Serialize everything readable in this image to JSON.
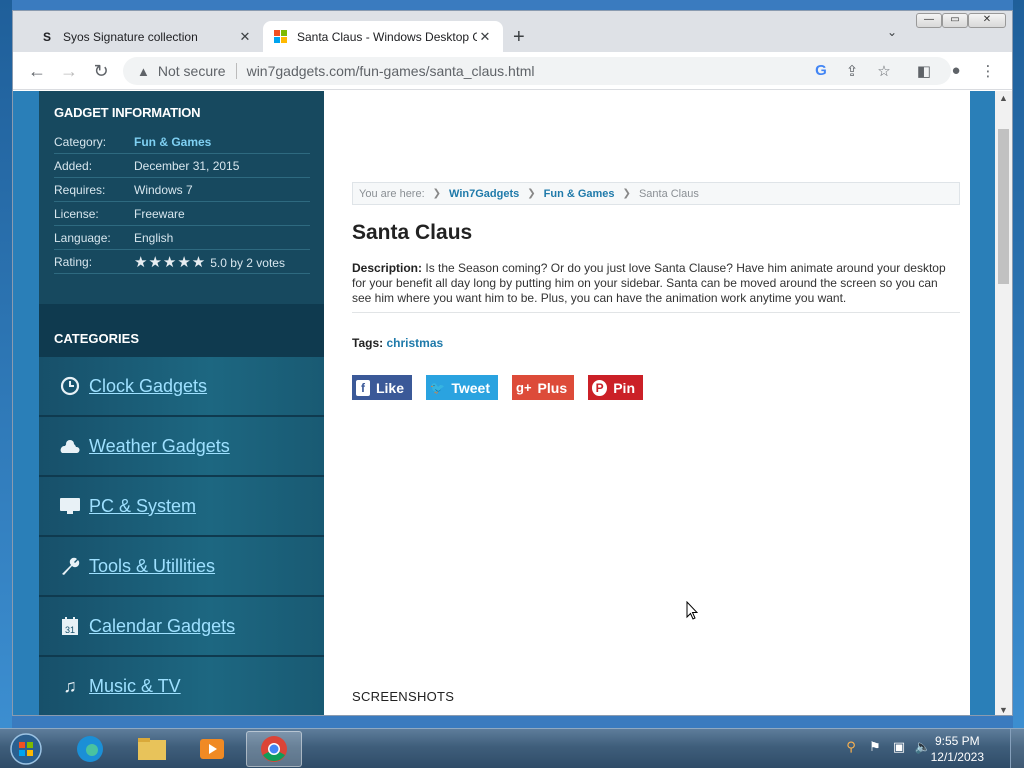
{
  "browser": {
    "tabs": [
      {
        "title": "Syos Signature collection",
        "favicon": "S"
      },
      {
        "title": "Santa Claus - Windows Desktop G",
        "favicon": "windows-logo"
      }
    ],
    "address": {
      "security": "Not secure",
      "url": "win7gadgets.com/fun-games/santa_claus.html"
    }
  },
  "sidebar": {
    "info_heading": "GADGET INFORMATION",
    "info": [
      {
        "key": "Category:",
        "value": "Fun & Games"
      },
      {
        "key": "Added:",
        "value": "December 31, 2015"
      },
      {
        "key": "Requires:",
        "value": "Windows 7"
      },
      {
        "key": "License:",
        "value": "Freeware"
      },
      {
        "key": "Language:",
        "value": "English"
      }
    ],
    "rating": {
      "key": "Rating:",
      "stars": 5,
      "text": "5.0 by 2 votes"
    },
    "categories_heading": "CATEGORIES",
    "categories": [
      {
        "label": "Clock Gadgets",
        "icon": "clock-icon"
      },
      {
        "label": "Weather Gadgets",
        "icon": "weather-icon"
      },
      {
        "label": "PC & System",
        "icon": "monitor-icon"
      },
      {
        "label": "Tools & Utillities",
        "icon": "wrench-icon"
      },
      {
        "label": "Calendar Gadgets",
        "icon": "calendar-icon"
      },
      {
        "label": "Music & TV",
        "icon": "music-note-icon"
      }
    ]
  },
  "content": {
    "breadcrumb": {
      "prefix": "You are here:",
      "items": [
        "Win7Gadgets",
        "Fun & Games"
      ],
      "current": "Santa Claus"
    },
    "title": "Santa Claus",
    "description_label": "Description:",
    "description": "Is the Season coming? Or do you just love Santa Clause? Have him animate around your desktop for your benefit all day long by putting him on your sidebar. Santa can be moved around the screen so you can see him where you want him to be. Plus, you can have the animation work anytime you want.",
    "tags_label": "Tags:",
    "tag": "christmas",
    "share": [
      {
        "label": "Like",
        "icon": "facebook-icon",
        "color": "#3b5998"
      },
      {
        "label": "Tweet",
        "icon": "twitter-icon",
        "color": "#2aa3e0"
      },
      {
        "label": "Plus",
        "icon": "google-plus-icon",
        "color": "#dd4b39"
      },
      {
        "label": "Pin",
        "icon": "pinterest-icon",
        "color": "#cb2027"
      }
    ],
    "screenshots_heading": "SCREENSHOTS"
  },
  "taskbar": {
    "time": "9:55 PM",
    "date": "12/1/2023"
  }
}
